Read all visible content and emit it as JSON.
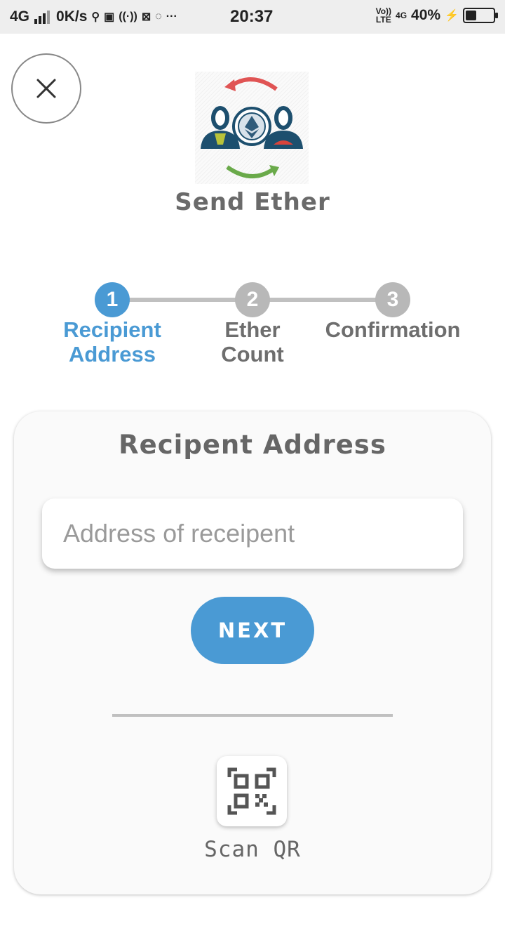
{
  "status_bar": {
    "network": "4G",
    "speed": "0K/s",
    "time": "20:37",
    "volte_top": "Vo))",
    "volte_bottom": "LTE",
    "network2": "4G",
    "battery_text": "40%",
    "battery_level": 0.4
  },
  "header": {
    "title": "Send Ether",
    "logo_icon": "send-ether-logo-icon",
    "close_icon": "close-icon"
  },
  "stepper": {
    "active_color": "#4a9ad4",
    "inactive_color": "#b8b8b8",
    "inactive_text_color": "#6e6e6e",
    "steps": [
      {
        "number": "1",
        "line1": "Recipient",
        "line2": "Address",
        "active": true
      },
      {
        "number": "2",
        "line1": "Ether",
        "line2": "Count",
        "active": false
      },
      {
        "number": "3",
        "line1": "Confirmation",
        "line2": "",
        "active": false
      }
    ]
  },
  "card": {
    "title": "Recipent Address",
    "input_placeholder": "Address of receipent",
    "input_value": "",
    "next_label": "NEXT",
    "scan_label": "Scan QR",
    "scan_icon": "qr-code-icon",
    "accent": "#4a9ad4"
  }
}
